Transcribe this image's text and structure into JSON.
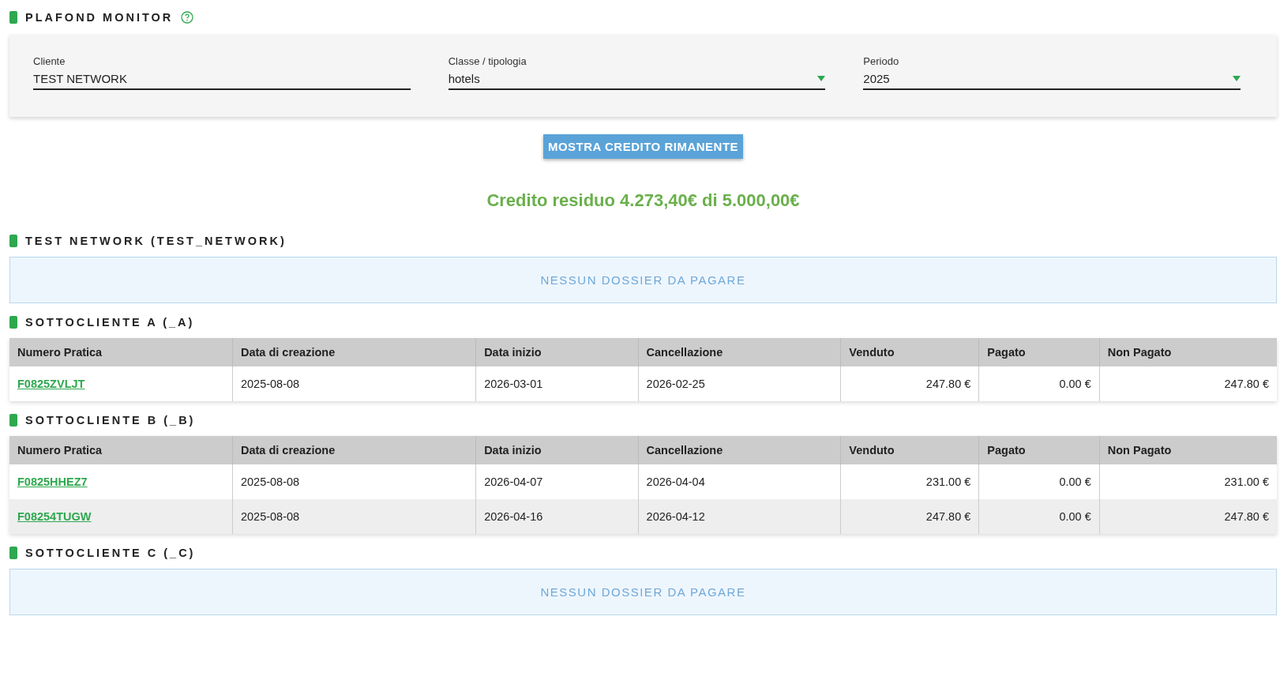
{
  "title": "PLAFOND MONITOR",
  "filters": [
    {
      "kind": "text",
      "label": "Cliente",
      "value": "TEST NETWORK"
    },
    {
      "kind": "select",
      "label": "Classe / tipologia",
      "value": "hotels"
    },
    {
      "kind": "select",
      "label": "Periodo",
      "value": "2025"
    }
  ],
  "action_button": "MOSTRA CREDITO RIMANENTE",
  "credit_summary": "Credito residuo 4.273,40€ di 5.000,00€",
  "sections": [
    {
      "title": "TEST NETWORK (TEST_NETWORK)",
      "kind": "empty",
      "message": "NESSUN DOSSIER DA PAGARE"
    },
    {
      "title": "SOTTOCLIENTE A (_A)",
      "kind": "table",
      "columns": [
        "Numero Pratica",
        "Data di creazione",
        "Data inizio",
        "Cancellazione",
        "Venduto",
        "Pagato",
        "Non Pagato"
      ],
      "rows": [
        [
          "F0825ZVLJT",
          "2025-08-08",
          "2026-03-01",
          "2026-02-25",
          "247.80 €",
          "0.00 €",
          "247.80 €"
        ]
      ]
    },
    {
      "title": "SOTTOCLIENTE B (_B)",
      "kind": "table",
      "columns": [
        "Numero Pratica",
        "Data di creazione",
        "Data inizio",
        "Cancellazione",
        "Venduto",
        "Pagato",
        "Non Pagato"
      ],
      "rows": [
        [
          "F0825HHEZ7",
          "2025-08-08",
          "2026-04-07",
          "2026-04-04",
          "231.00 €",
          "0.00 €",
          "231.00 €"
        ],
        [
          "F08254TUGW",
          "2025-08-08",
          "2026-04-16",
          "2026-04-12",
          "247.80 €",
          "0.00 €",
          "247.80 €"
        ]
      ]
    },
    {
      "title": "SOTTOCLIENTE C (_C)",
      "kind": "empty",
      "message": "NESSUN DOSSIER DA PAGARE"
    }
  ]
}
